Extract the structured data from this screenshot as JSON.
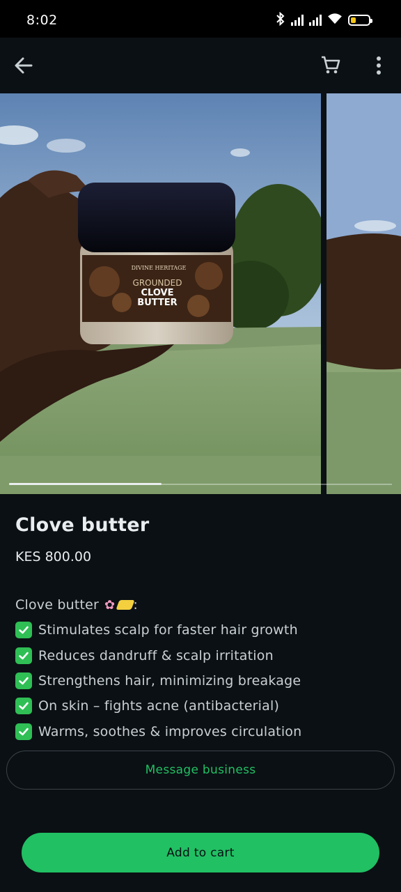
{
  "status_bar": {
    "time": "8:02",
    "icons": [
      "bluetooth-icon",
      "signal-icon",
      "signal-icon",
      "wifi-icon",
      "battery-icon"
    ],
    "battery_color": "#f5c518"
  },
  "app_bar": {
    "back_icon": "arrow-left-icon",
    "cart_icon": "cart-icon",
    "menu_icon": "more-vertical-icon"
  },
  "carousel": {
    "images": [
      "clove-butter-jar-photo",
      "arm-photo"
    ],
    "jar_label": {
      "brand": "DIVINE HERITAGE",
      "line1": "GROUNDED",
      "line2": "CLOVE",
      "line3": "BUTTER"
    },
    "active_index": 0,
    "total": 3
  },
  "product": {
    "title": "Clove butter",
    "price": "KES 800.00",
    "description_heading": "Clove butter",
    "bullets": [
      "Stimulates scalp for faster hair growth",
      "Reduces dandruff & scalp irritation",
      "Strengthens hair, minimizing breakage",
      "On skin – fights acne (antibacterial)",
      "Warms, soothes & improves circulation"
    ]
  },
  "actions": {
    "message_label": "Message business",
    "add_to_cart_label": "Add to cart"
  },
  "colors": {
    "accent": "#21c063",
    "background": "#0b1014",
    "check": "#2fbf55"
  }
}
